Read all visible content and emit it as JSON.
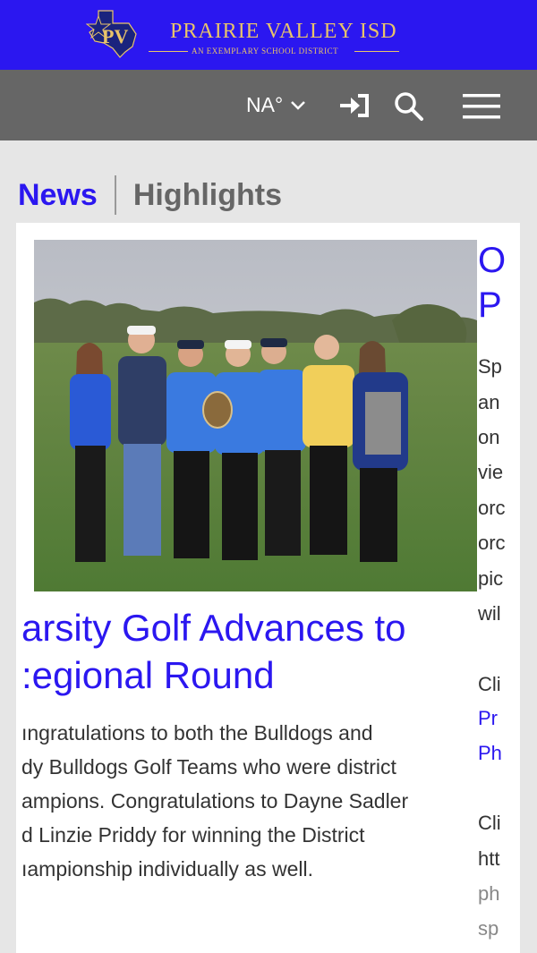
{
  "header": {
    "logo_monogram": "PV",
    "title": "PRAIRIE VALLEY ISD",
    "subtitle": "AN EXEMPLARY SCHOOL DISTRICT",
    "bg_color": "#2b17f0",
    "logo_color": "#e9c46a"
  },
  "toolbar": {
    "weather_label": "NA°",
    "icons": [
      "chevron-down-icon",
      "sign-in-icon",
      "search-icon",
      "hamburger-menu-icon"
    ]
  },
  "tabs": [
    {
      "label": "News",
      "active": true
    },
    {
      "label": "Highlights",
      "active": false
    }
  ],
  "article": {
    "headline_line1": "arsity Golf Advances to",
    "headline_line2": ":egional Round",
    "summary_lines": [
      "ıngratulations to both the Bulldogs and",
      "dy Bulldogs Golf Teams who were district",
      "ampions. Congratulations to Dayne Sadler",
      "d Linzie Priddy for winning the District",
      "ıampionship individually as well."
    ]
  },
  "next_article": {
    "title_lines": [
      "O",
      "P"
    ],
    "body_lines": [
      "Sp",
      "an",
      "on",
      "vie",
      "orc",
      "orc",
      "pic",
      "wil"
    ],
    "click_line_1": "Cli",
    "link_lines": [
      "Pr",
      "Ph"
    ],
    "click_line_2": "Cli",
    "url_lines": [
      "htt",
      "ph",
      "sp"
    ]
  }
}
